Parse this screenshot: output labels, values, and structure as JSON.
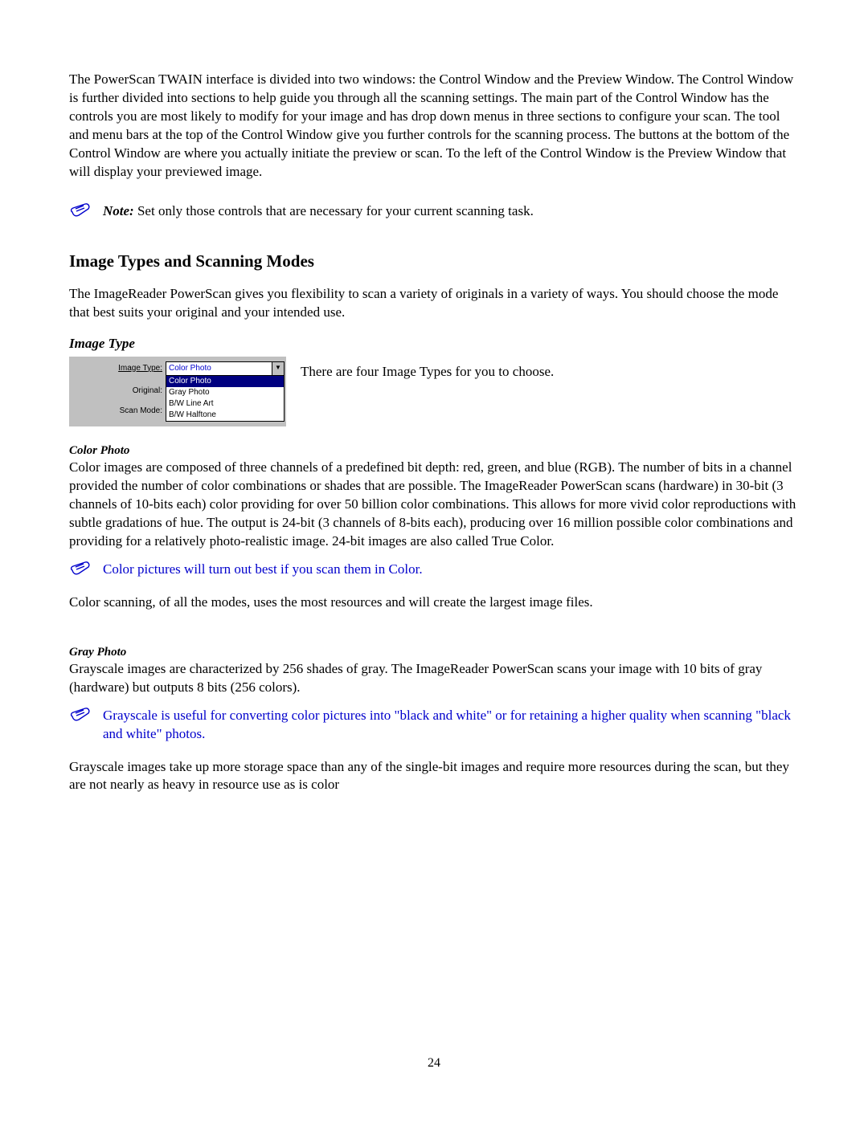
{
  "intro": "The PowerScan TWAIN interface is divided into two windows: the Control Window and the Preview Window.  The Control Window is further divided into sections to help guide you through all the scanning settings.  The main part of the Control Window has the controls you are most likely to modify for your image and has drop down menus in three sections to configure your scan.  The tool and menu bars at the top of the Control Window give you further controls for the scanning process.  The buttons at the bottom of the Control Window are where you actually initiate the preview or scan.  To the left of the Control Window is the Preview Window that will display your previewed image.",
  "note1": {
    "label": "Note:",
    "text": " Set only those controls that are necessary for your current scanning task."
  },
  "heading_modes": "Image Types and Scanning Modes",
  "modes_intro": "The ImageReader PowerScan gives you flexibility to scan a variety of originals in a variety of ways.  You should choose the mode that best suits your original and your intended use.",
  "image_type_heading": "Image Type",
  "image_type_caption": "There are four Image Types for you to choose.",
  "dropdown": {
    "label_image_type": "Image Type:",
    "label_original": "Original:",
    "label_scan_mode": "Scan Mode:",
    "selected": "Color Photo",
    "options": [
      "Color Photo",
      "Gray Photo",
      "B/W Line Art",
      "B/W Halftone"
    ]
  },
  "color_photo_heading": "Color Photo",
  "color_photo_body": "Color images are composed of three channels of a predefined bit depth: red, green, and blue (RGB).  The number of bits in a channel provided the number of color combinations or shades that are possible.  The ImageReader PowerScan scans (hardware) in 30-bit (3 channels of 10-bits each) color providing for over 50 billion color combinations.  This allows for more vivid color reproductions with subtle gradations of hue.  The output is 24-bit (3 channels of 8-bits each), producing over 16 million possible color combinations and providing for a relatively photo-realistic image. 24-bit images are also called True Color.",
  "note2_text": "Color pictures will turn out best if you scan them in Color.",
  "color_photo_tail": "Color scanning, of all the modes, uses the most resources and will create the largest image files.",
  "gray_photo_heading": "Gray Photo",
  "gray_photo_body": "Grayscale images are characterized by 256 shades of gray.  The ImageReader PowerScan scans your image with 10 bits of gray (hardware) but outputs 8 bits (256 colors).",
  "note3_text": "Grayscale is useful for converting color pictures into \"black and white\" or for retaining a higher quality when scanning \"black and white\" photos.",
  "gray_photo_tail": "Grayscale images take up more storage space than any of the single-bit images and require more resources during the scan, but they are not nearly as heavy in resource use as is color",
  "page_number": "24"
}
